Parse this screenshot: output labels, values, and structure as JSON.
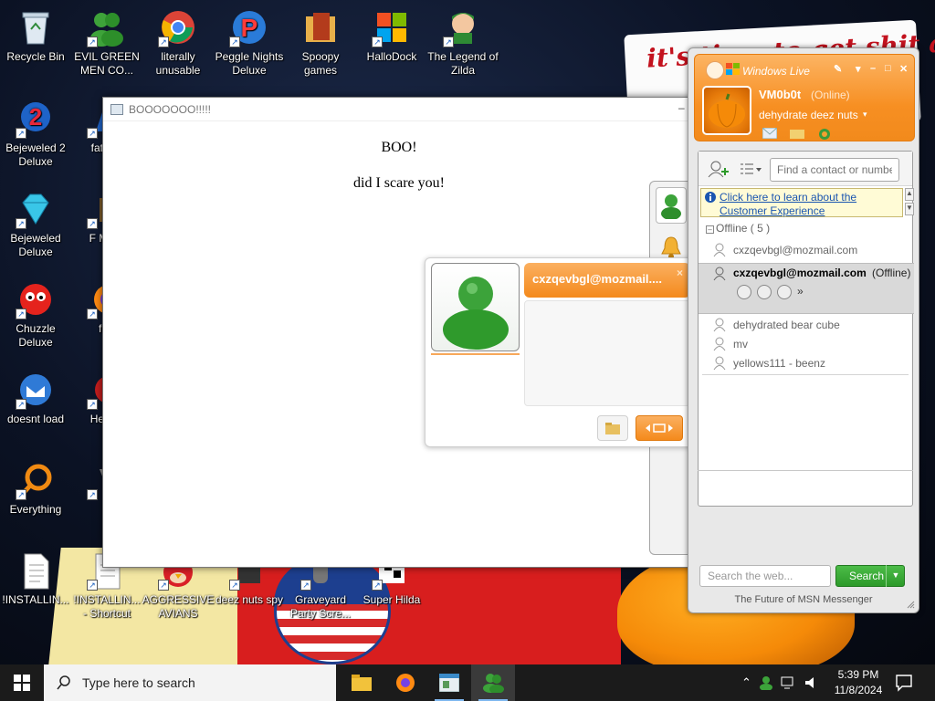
{
  "desktop": {
    "wallpaper_text": "it's time to get shit and",
    "icons": [
      {
        "label": "Recycle Bin",
        "icon": "recycle-bin-icon"
      },
      {
        "label": "EVIL GREEN MEN CO...",
        "icon": "green-men-icon"
      },
      {
        "label": "literally unusable",
        "icon": "chrome-icon"
      },
      {
        "label": "Peggle Nights Deluxe",
        "icon": "peggle-icon"
      },
      {
        "label": "Spoopy games",
        "icon": "folder-icon"
      },
      {
        "label": "HalloDock",
        "icon": "windows-logo-icon"
      },
      {
        "label": "The Legend of Zilda",
        "icon": "zilda-icon"
      },
      {
        "label": "Bejeweled 2 Deluxe",
        "icon": "bejeweled2-icon"
      },
      {
        "label": "fat like",
        "icon": "app-icon"
      },
      {
        "label": "Bejeweled Deluxe",
        "icon": "diamond-icon"
      },
      {
        "label": "F MON",
        "icon": "app-icon"
      },
      {
        "label": "Chuzzle Deluxe",
        "icon": "chuzzle-icon"
      },
      {
        "label": "furr",
        "icon": "firefox-icon"
      },
      {
        "label": "doesnt load",
        "icon": "thunderbird-icon"
      },
      {
        "label": "He We",
        "icon": "app-icon"
      },
      {
        "label": "Everything",
        "icon": "everything-search-icon"
      },
      {
        "label": "is",
        "icon": "app-icon"
      },
      {
        "label": "!INSTALLIN...",
        "icon": "document-icon"
      },
      {
        "label": "!INSTALLIN... - Shortcut",
        "icon": "document-icon"
      },
      {
        "label": "AGGRESSIVE AVIANS",
        "icon": "angry-bird-icon"
      },
      {
        "label": "deez nuts spy",
        "icon": "spy-icon"
      },
      {
        "label": "Graveyard Party Scre...",
        "icon": "graveyard-icon"
      },
      {
        "label": "Super Hilda",
        "icon": "hilda-icon"
      }
    ]
  },
  "boo_window": {
    "title": "BOOOOOOO!!!!!",
    "line1": "BOO!",
    "line2": "did I scare you!"
  },
  "contact_card": {
    "email": "cxzqevbgl@mozmail....",
    "close": "×"
  },
  "messenger": {
    "app_title": "Windows Live",
    "display_name": "VM0b0t",
    "status": "(Online)",
    "personal_message": "dehydrate deez nuts",
    "search_placeholder": "Find a contact or number...",
    "banner_line1": "Click here to learn about the",
    "banner_line2": "Customer Experience",
    "group_label": "Offline ( 5 )",
    "contacts": [
      "cxzqevbgl@mozmail.com",
      "dehydrated bear cube",
      "mv",
      "yellows111 - beenz"
    ],
    "selected_contact": {
      "name": "cxzqevbgl@mozmail.com",
      "status": "(Offline)"
    },
    "web_search_placeholder": "Search the web...",
    "search_button": "Search",
    "footer": "The Future of MSN Messenger",
    "accent_color": "#f78f22"
  },
  "taskbar": {
    "search_placeholder": "Type here to search",
    "time": "5:39 PM",
    "date": "11/8/2024",
    "apps": [
      "file-explorer-icon",
      "firefox-icon",
      "app-window-icon",
      "messenger-icon"
    ]
  }
}
